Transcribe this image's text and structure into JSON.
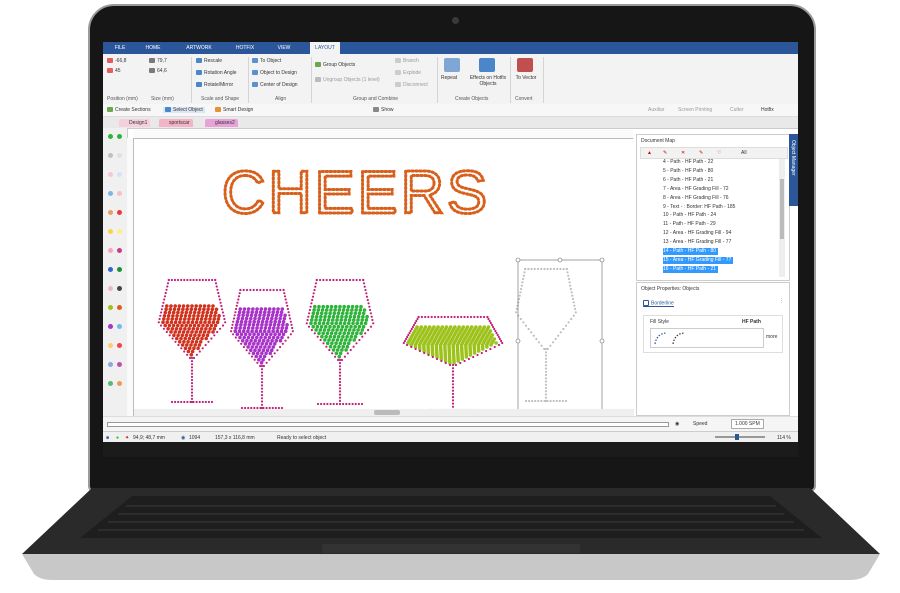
{
  "ribbon_tabs": [
    "FILE",
    "HOME",
    "ARTWORK",
    "HOTFIX",
    "VIEW",
    "LAYOUT"
  ],
  "position": {
    "x": "-66,8",
    "y": "45",
    "w": "79,7",
    "h": "64,6",
    "group_label": "Position (mm)",
    "size_label": "Size (mm)"
  },
  "ribbon": {
    "scale_shape": {
      "items": [
        "Rescale",
        "Rotation Angle",
        "Rotate/Mirror"
      ],
      "label": "Scale and Shape"
    },
    "align": {
      "items": [
        "To Object",
        "Object to Design",
        "Center of Design"
      ],
      "label": "Align"
    },
    "group_combine": {
      "items": [
        "Group Objects",
        "Ungroup Objects (1 level)",
        "Branch",
        "Explode",
        "Disconnect"
      ],
      "label": "Group and Combine"
    },
    "create_objects": {
      "repeat": "Repeat",
      "effects": "Effects on Hotfix Objects",
      "label": "Create Objects"
    },
    "convert": {
      "to_vector": "To Vector",
      "label": "Convert"
    }
  },
  "toolbar": {
    "create_sections": "Create Sections",
    "select_object": "Select Object",
    "smart_design": "Smart Design",
    "show": "Show",
    "auxiliar": "Auxiliar",
    "screen_printing": "Screen Printing",
    "cutter": "Cutter",
    "hotfix": "Hotfix"
  },
  "doc_tabs": [
    "Design1",
    "sportscar",
    "glasses2"
  ],
  "canvas": {
    "heading": "CHEERS"
  },
  "document_map": {
    "title": "Document Map",
    "all_label": "All",
    "items": [
      {
        "label": "4 - Path - HF Path - 22",
        "selected": false
      },
      {
        "label": "5 - Path - HF Path - 80",
        "selected": false
      },
      {
        "label": "6 - Path - HF Path - 21",
        "selected": false
      },
      {
        "label": "7 - Area - HF Grading Fill - 72",
        "selected": false
      },
      {
        "label": "8 - Area - HF Grading Fill - 76",
        "selected": false
      },
      {
        "label": "9 - Text - : Border: HF Path - 185",
        "selected": false
      },
      {
        "label": "10 - Path - HF Path - 24",
        "selected": false
      },
      {
        "label": "11 - Path - HF Path - 29",
        "selected": false
      },
      {
        "label": "12 - Area - HF Grading Fill - 94",
        "selected": false
      },
      {
        "label": "13 - Area - HF Grading Fill - 77",
        "selected": false
      },
      {
        "label": "14 - Path - HF Path - 80",
        "selected": true
      },
      {
        "label": "15 - Area - HF Grading Fill - 77",
        "selected": true
      },
      {
        "label": "16 - Path - HF Path - 21",
        "selected": true
      }
    ]
  },
  "object_properties": {
    "title": "Object Properties: Objects",
    "tab": "Borderline",
    "fill_style_label": "Fill Style",
    "fill_style_value": "HF Path",
    "more": "more"
  },
  "object_manager_tab": "Object Manager",
  "timeline": {
    "speed_label": "Speed",
    "speed_value": "1.000 SPM"
  },
  "status": {
    "coords": "94,9; 48,7 mm",
    "count": "1094",
    "size": "157,3 x 116,8 mm",
    "message": "Ready to select object",
    "zoom": "114 %"
  },
  "colors": {
    "ribbon_blue": "#2b579a",
    "wine_red": "#d0321e",
    "wine_purple": "#a733c9",
    "wine_green": "#2fb33a",
    "wine_lime": "#9dc21c",
    "stem_magenta": "#c0227a",
    "cheers_orange": "#d9601c"
  }
}
